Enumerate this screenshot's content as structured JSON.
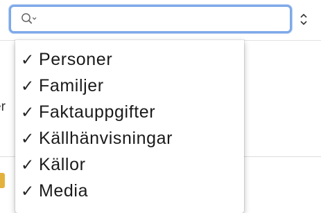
{
  "search": {
    "value": "",
    "placeholder": "",
    "icon": "search-with-dropdown-icon",
    "focus_color": "#7ea9e8"
  },
  "scope_stepper": {
    "icon": "up-down-chevron-icon"
  },
  "background": {
    "text_fragment": "er"
  },
  "menu": {
    "checkmark": "✓",
    "items": [
      {
        "label": "Personer",
        "checked": true
      },
      {
        "label": "Familjer",
        "checked": true
      },
      {
        "label": "Faktauppgifter",
        "checked": true
      },
      {
        "label": "Källhänvisningar",
        "checked": true
      },
      {
        "label": "Källor",
        "checked": true
      },
      {
        "label": "Media",
        "checked": true
      }
    ]
  }
}
